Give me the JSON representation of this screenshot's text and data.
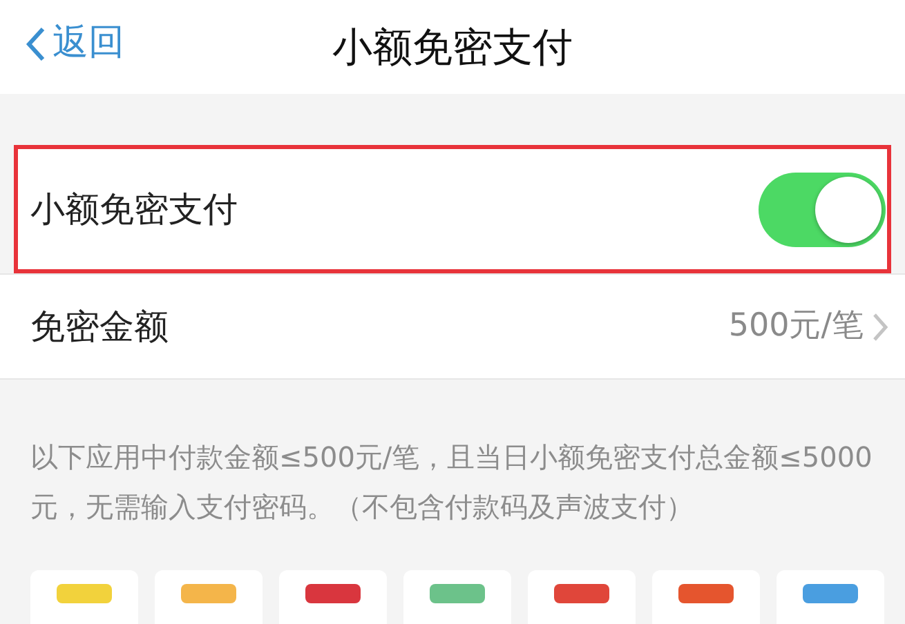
{
  "nav": {
    "back": "返回",
    "title": "小额免密支付"
  },
  "settings": [
    {
      "kind": "toggle",
      "label": "小额免密支付",
      "on": true,
      "highlighted": true
    },
    {
      "kind": "link",
      "label": "免密金额",
      "value": "500元/笔",
      "highlighted": false
    }
  ],
  "description": "以下应用中付款金额≤500元/笔，且当日小额免密支付总金额≤5000元，无需输入支付密码。（不包含付款码及声波支付）",
  "apps": [
    {
      "color": "#f2d23c"
    },
    {
      "color": "#f4b54a"
    },
    {
      "color": "#d9363e"
    },
    {
      "color": "#6cc28a"
    },
    {
      "color": "#e0463a"
    },
    {
      "color": "#e5552e"
    },
    {
      "color": "#4a9ee0"
    }
  ]
}
